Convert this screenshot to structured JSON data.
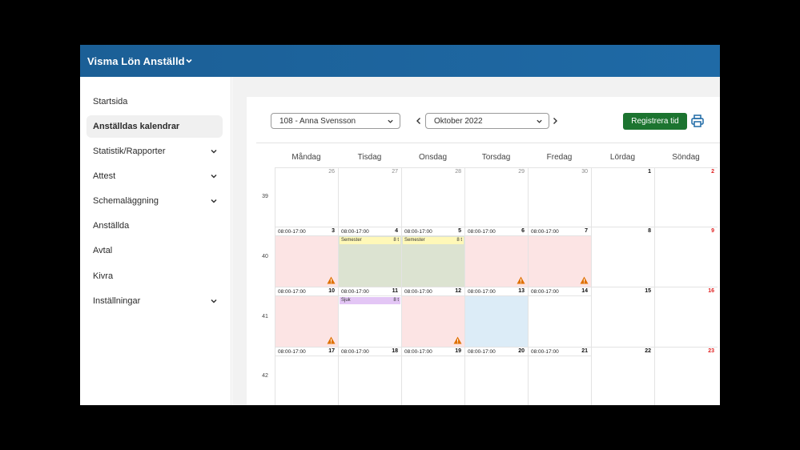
{
  "app": {
    "title": "Visma Lön Anställd"
  },
  "sidebar": {
    "items": [
      {
        "label": "Startsida",
        "has_chevron": false,
        "active": false
      },
      {
        "label": "Anställdas kalendrar",
        "has_chevron": false,
        "active": true
      },
      {
        "label": "Statistik/Rapporter",
        "has_chevron": true,
        "active": false
      },
      {
        "label": "Attest",
        "has_chevron": true,
        "active": false
      },
      {
        "label": "Schemaläggning",
        "has_chevron": true,
        "active": false
      },
      {
        "label": "Anställda",
        "has_chevron": false,
        "active": false
      },
      {
        "label": "Avtal",
        "has_chevron": false,
        "active": false
      },
      {
        "label": "Kivra",
        "has_chevron": false,
        "active": false
      },
      {
        "label": "Inställningar",
        "has_chevron": true,
        "active": false
      }
    ]
  },
  "toolbar": {
    "employee_value": "108 - Anna Svensson",
    "month_value": "Oktober 2022",
    "register_label": "Registrera tid"
  },
  "colors": {
    "accent": "#1f6aa6",
    "register_button": "#1c7430",
    "deviation_bg": "#fce4e4",
    "vacation_bg": "#dce3d1",
    "vacation_tag": "#fff8b8",
    "sick_tag": "#e3c6f5",
    "selected_bg": "#dcecf7",
    "sunday_red": "#e02020",
    "warning": "#e07000"
  },
  "calendar": {
    "weekdays": [
      "Måndag",
      "Tisdag",
      "Onsdag",
      "Torsdag",
      "Fredag",
      "Lördag",
      "Söndag"
    ],
    "weeks": [
      {
        "number": "39",
        "days": [
          {
            "day": "26",
            "style": "grey"
          },
          {
            "day": "27",
            "style": "grey"
          },
          {
            "day": "28",
            "style": "grey"
          },
          {
            "day": "29",
            "style": "grey"
          },
          {
            "day": "30",
            "style": "grey"
          },
          {
            "day": "1",
            "style": "bold"
          },
          {
            "day": "2",
            "style": "red"
          }
        ]
      },
      {
        "number": "40",
        "days": [
          {
            "day": "3",
            "style": "bold",
            "time": "08:00-17:00",
            "bg": "pink",
            "warning": true
          },
          {
            "day": "4",
            "style": "bold",
            "time": "08:00-17:00",
            "bg": "green",
            "event": {
              "name": "Semester",
              "hours": "8 t",
              "kind": "vacation"
            }
          },
          {
            "day": "5",
            "style": "bold",
            "time": "08:00-17:00",
            "bg": "green",
            "event": {
              "name": "Semester",
              "hours": "8 t",
              "kind": "vacation"
            }
          },
          {
            "day": "6",
            "style": "bold",
            "time": "08:00-17:00",
            "bg": "pink",
            "warning": true
          },
          {
            "day": "7",
            "style": "bold",
            "time": "08:00-17:00",
            "bg": "pink",
            "warning": true
          },
          {
            "day": "8",
            "style": "bold"
          },
          {
            "day": "9",
            "style": "red"
          }
        ]
      },
      {
        "number": "41",
        "days": [
          {
            "day": "10",
            "style": "bold",
            "time": "08:00-17:00",
            "bg": "pink",
            "warning": true
          },
          {
            "day": "11",
            "style": "bold",
            "time": "08:00-17:00",
            "event": {
              "name": "Sjuk",
              "hours": "8 t",
              "kind": "sick"
            }
          },
          {
            "day": "12",
            "style": "bold",
            "time": "08:00-17:00",
            "bg": "pink",
            "warning": true
          },
          {
            "day": "13",
            "style": "bold",
            "time": "08:00-17:00",
            "bg": "blue"
          },
          {
            "day": "14",
            "style": "bold",
            "time": "08:00-17:00"
          },
          {
            "day": "15",
            "style": "bold"
          },
          {
            "day": "16",
            "style": "red"
          }
        ]
      },
      {
        "number": "42",
        "days": [
          {
            "day": "17",
            "style": "bold",
            "time": "08:00-17:00"
          },
          {
            "day": "18",
            "style": "bold",
            "time": "08:00-17:00"
          },
          {
            "day": "19",
            "style": "bold",
            "time": "08:00-17:00"
          },
          {
            "day": "20",
            "style": "bold",
            "time": "08:00-17:00"
          },
          {
            "day": "21",
            "style": "bold",
            "time": "08:00-17:00"
          },
          {
            "day": "22",
            "style": "bold"
          },
          {
            "day": "23",
            "style": "red"
          }
        ]
      }
    ]
  }
}
